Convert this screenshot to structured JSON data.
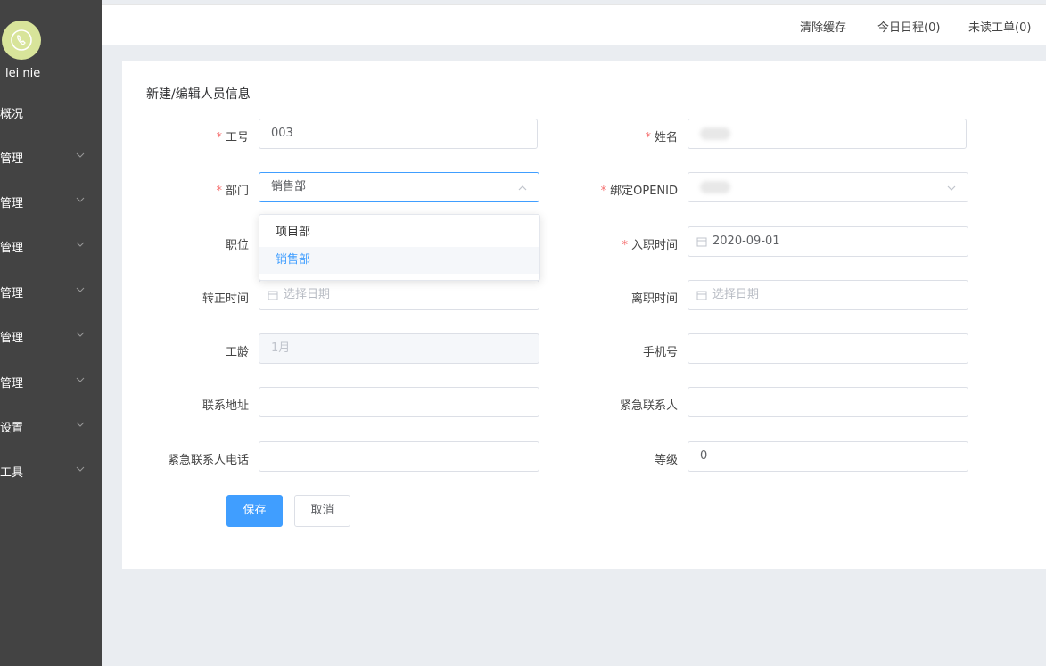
{
  "sidebar": {
    "username": "lei nie",
    "items": [
      {
        "label": "概况",
        "has_submenu": false
      },
      {
        "label": "管理",
        "has_submenu": true
      },
      {
        "label": "管理",
        "has_submenu": true
      },
      {
        "label": "管理",
        "has_submenu": true
      },
      {
        "label": "管理",
        "has_submenu": true
      },
      {
        "label": "管理",
        "has_submenu": true
      },
      {
        "label": "管理",
        "has_submenu": true
      },
      {
        "label": "设置",
        "has_submenu": true
      },
      {
        "label": "工具",
        "has_submenu": true
      }
    ]
  },
  "topbar": {
    "clear_cache": "清除缓存",
    "today_schedule": "今日日程(0)",
    "unread_orders": "未读工单(0)"
  },
  "form": {
    "title": "新建/编辑人员信息",
    "fields": {
      "employee_id": {
        "label": "工号",
        "required": true,
        "value": "003"
      },
      "name": {
        "label": "姓名",
        "required": true,
        "value": ""
      },
      "department": {
        "label": "部门",
        "required": true,
        "value": "销售部",
        "open": true
      },
      "openid": {
        "label": "绑定OPENID",
        "required": true,
        "value": ""
      },
      "position": {
        "label": "职位",
        "required": false
      },
      "hire_date": {
        "label": "入职时间",
        "required": true,
        "value": "2020-09-01"
      },
      "regular_date": {
        "label": "转正时间",
        "required": false,
        "placeholder": "选择日期"
      },
      "leave_date": {
        "label": "离职时间",
        "required": false,
        "placeholder": "选择日期"
      },
      "seniority": {
        "label": "工龄",
        "required": false,
        "value": "1月",
        "disabled": true
      },
      "phone": {
        "label": "手机号",
        "required": false,
        "value": ""
      },
      "address": {
        "label": "联系地址",
        "required": false,
        "value": ""
      },
      "emergency_contact": {
        "label": "紧急联系人",
        "required": false,
        "value": ""
      },
      "emergency_phone": {
        "label": "紧急联系人电话",
        "required": false,
        "value": ""
      },
      "level": {
        "label": "等级",
        "required": false,
        "value": "0"
      }
    },
    "department_options": [
      {
        "label": "项目部",
        "selected": false
      },
      {
        "label": "销售部",
        "selected": true
      }
    ],
    "save_label": "保存",
    "cancel_label": "取消"
  },
  "colors": {
    "primary": "#409eff",
    "required_mark": "#f56c6c",
    "sidebar_bg": "#434343",
    "avatar_bg": "#d8e49a"
  }
}
